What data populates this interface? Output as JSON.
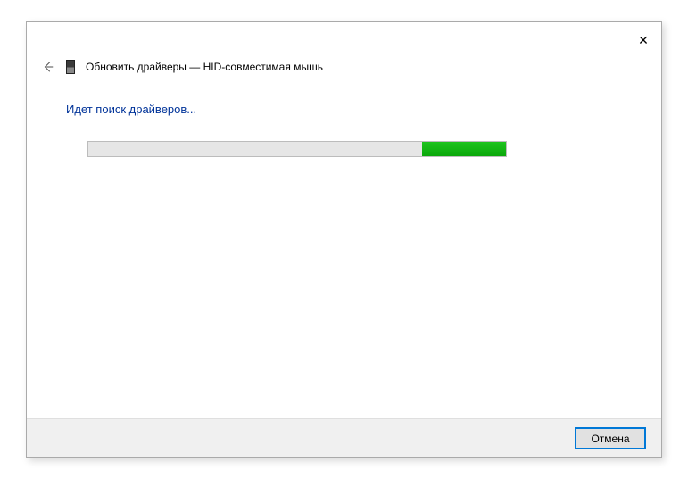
{
  "header": {
    "title": "Обновить драйверы — HID-совместимая мышь"
  },
  "content": {
    "status_text": "Идет поиск драйверов...",
    "progress": {
      "indeterminate_left_percent": 80,
      "indeterminate_width_percent": 20
    }
  },
  "footer": {
    "cancel_label": "Отмена"
  },
  "icons": {
    "close": "✕"
  }
}
